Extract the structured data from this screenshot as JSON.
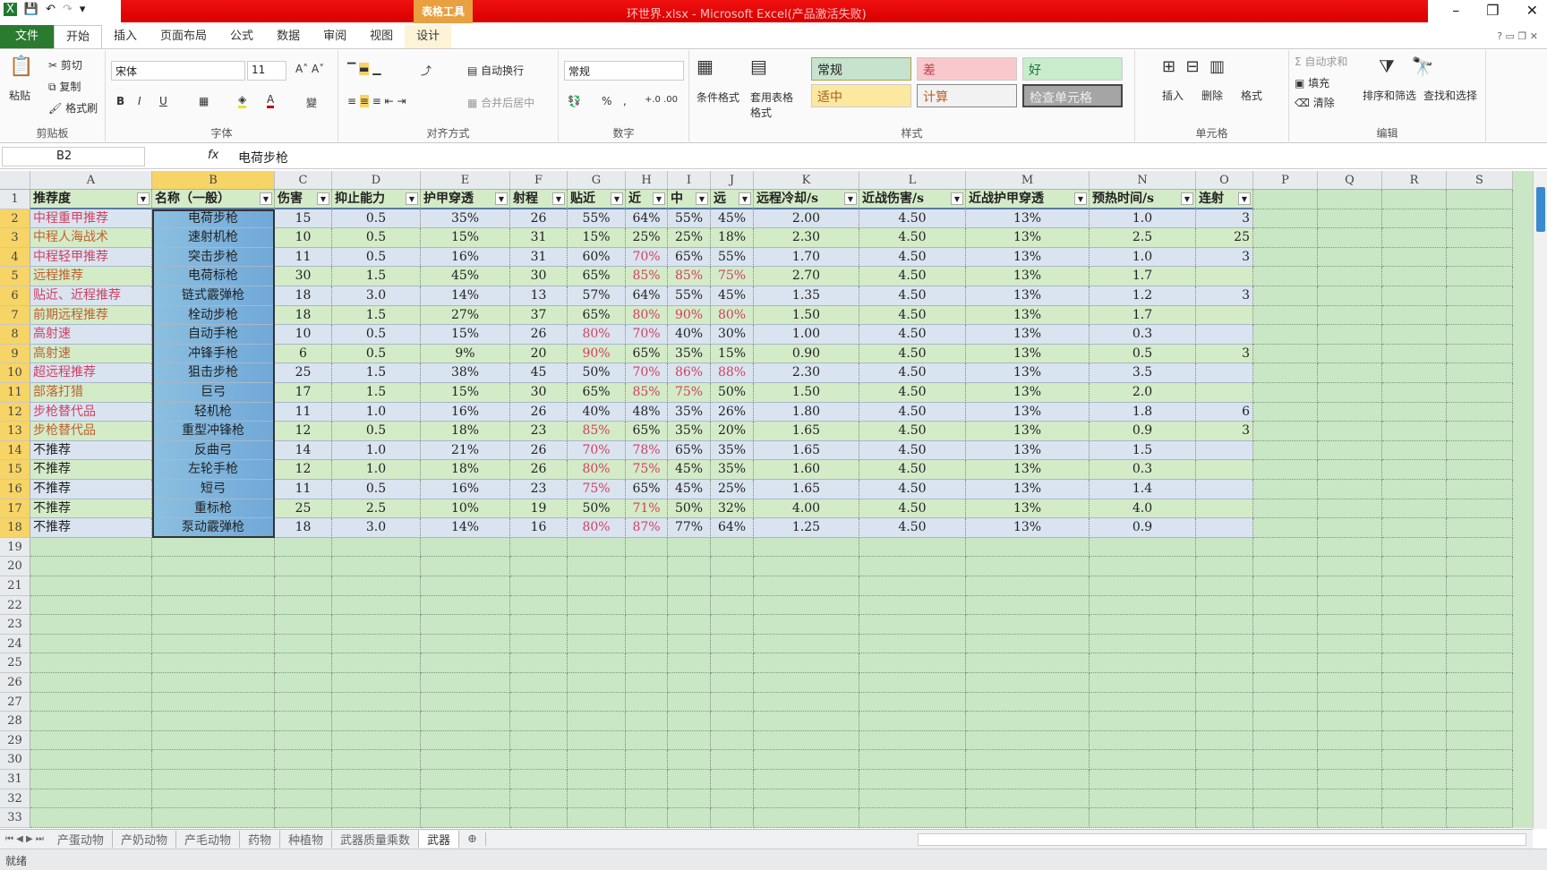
{
  "titlebar": {
    "title": "环世界.xlsx - Microsoft Excel(产品激活失败)",
    "table_tools": "表格工具"
  },
  "tabs": [
    "文件",
    "开始",
    "插入",
    "页面布局",
    "公式",
    "数据",
    "审阅",
    "视图",
    "设计"
  ],
  "ribbon": {
    "clipboard": {
      "paste": "粘贴",
      "cut": "剪切",
      "copy": "复制",
      "format_painter": "格式刷",
      "label": "剪贴板"
    },
    "font": {
      "name": "宋体",
      "size": "11",
      "label": "字体",
      "bold": "B",
      "italic": "I",
      "underline": "U"
    },
    "alignment": {
      "wrap": "自动换行",
      "merge": "合并后居中",
      "label": "对齐方式"
    },
    "number": {
      "format": "常规",
      "percent": "%",
      "comma": ",",
      "label": "数字"
    },
    "styles": {
      "conditional": "条件格式",
      "table_format": "套用表格格式",
      "label": "样式",
      "cells": [
        "常规",
        "差",
        "好",
        "适中",
        "计算",
        "检查单元格"
      ]
    },
    "cells": {
      "insert": "插入",
      "delete": "删除",
      "format": "格式",
      "label": "单元格"
    },
    "editing": {
      "autosum": "自动求和",
      "fill": "填充",
      "clear": "清除",
      "sort": "排序和筛选",
      "find": "查找和选择",
      "label": "编辑"
    }
  },
  "formula_bar": {
    "name_box": "B2",
    "fx": "fx",
    "value": "电荷步枪"
  },
  "columns": [
    "A",
    "B",
    "C",
    "D",
    "E",
    "F",
    "G",
    "H",
    "I",
    "J",
    "K",
    "L",
    "M",
    "N",
    "O",
    "P",
    "Q",
    "R",
    "S"
  ],
  "headers": [
    "推荐度",
    "名称（一般）",
    "伤害",
    "抑止能力",
    "护甲穿透",
    "射程",
    "贴近",
    "近",
    "中",
    "远",
    "远程冷却/s",
    "近战伤害/s",
    "近战护甲穿透",
    "预热时间/s",
    "连射"
  ],
  "rows": [
    [
      "中程重甲推荐",
      "电荷步枪",
      "15",
      "0.5",
      "35%",
      "26",
      "55%",
      "64%",
      "55%",
      "45%",
      "2.00",
      "4.50",
      "13%",
      "1.0",
      "3"
    ],
    [
      "中程人海战术",
      "速射机枪",
      "10",
      "0.5",
      "15%",
      "31",
      "15%",
      "25%",
      "25%",
      "18%",
      "2.30",
      "4.50",
      "13%",
      "2.5",
      "25"
    ],
    [
      "中程轻甲推荐",
      "突击步枪",
      "11",
      "0.5",
      "16%",
      "31",
      "60%",
      "70%",
      "65%",
      "55%",
      "1.70",
      "4.50",
      "13%",
      "1.0",
      "3"
    ],
    [
      "远程推荐",
      "电荷标枪",
      "30",
      "1.5",
      "45%",
      "30",
      "65%",
      "85%",
      "85%",
      "75%",
      "2.70",
      "4.50",
      "13%",
      "1.7",
      ""
    ],
    [
      "贴近、近程推荐",
      "链式霰弹枪",
      "18",
      "3.0",
      "14%",
      "13",
      "57%",
      "64%",
      "55%",
      "45%",
      "1.35",
      "4.50",
      "13%",
      "1.2",
      "3"
    ],
    [
      "前期远程推荐",
      "栓动步枪",
      "18",
      "1.5",
      "27%",
      "37",
      "65%",
      "80%",
      "90%",
      "80%",
      "1.50",
      "4.50",
      "13%",
      "1.7",
      ""
    ],
    [
      "高射速",
      "自动手枪",
      "10",
      "0.5",
      "15%",
      "26",
      "80%",
      "70%",
      "40%",
      "30%",
      "1.00",
      "4.50",
      "13%",
      "0.3",
      ""
    ],
    [
      "高射速",
      "冲锋手枪",
      "6",
      "0.5",
      "9%",
      "20",
      "90%",
      "65%",
      "35%",
      "15%",
      "0.90",
      "4.50",
      "13%",
      "0.5",
      "3"
    ],
    [
      "超远程推荐",
      "狙击步枪",
      "25",
      "1.5",
      "38%",
      "45",
      "50%",
      "70%",
      "86%",
      "88%",
      "2.30",
      "4.50",
      "13%",
      "3.5",
      ""
    ],
    [
      "部落打猎",
      "巨弓",
      "17",
      "1.5",
      "15%",
      "30",
      "65%",
      "85%",
      "75%",
      "50%",
      "1.50",
      "4.50",
      "13%",
      "2.0",
      ""
    ],
    [
      "步枪替代品",
      "轻机枪",
      "11",
      "1.0",
      "16%",
      "26",
      "40%",
      "48%",
      "35%",
      "26%",
      "1.80",
      "4.50",
      "13%",
      "1.8",
      "6"
    ],
    [
      "步枪替代品",
      "重型冲锋枪",
      "12",
      "0.5",
      "18%",
      "23",
      "85%",
      "65%",
      "35%",
      "20%",
      "1.65",
      "4.50",
      "13%",
      "0.9",
      "3"
    ],
    [
      "不推荐",
      "反曲弓",
      "14",
      "1.0",
      "21%",
      "26",
      "70%",
      "78%",
      "65%",
      "35%",
      "1.65",
      "4.50",
      "13%",
      "1.5",
      ""
    ],
    [
      "不推荐",
      "左轮手枪",
      "12",
      "1.0",
      "18%",
      "26",
      "80%",
      "75%",
      "45%",
      "35%",
      "1.60",
      "4.50",
      "13%",
      "0.3",
      ""
    ],
    [
      "不推荐",
      "短弓",
      "11",
      "0.5",
      "16%",
      "23",
      "75%",
      "65%",
      "45%",
      "25%",
      "1.65",
      "4.50",
      "13%",
      "1.4",
      ""
    ],
    [
      "不推荐",
      "重标枪",
      "25",
      "2.5",
      "10%",
      "19",
      "50%",
      "71%",
      "50%",
      "32%",
      "4.00",
      "4.50",
      "13%",
      "4.0",
      ""
    ],
    [
      "不推荐",
      "泵动霰弹枪",
      "18",
      "3.0",
      "14%",
      "16",
      "80%",
      "87%",
      "77%",
      "64%",
      "1.25",
      "4.50",
      "13%",
      "0.9",
      ""
    ]
  ],
  "highlight": {
    "2": [
      7
    ],
    "3": [
      7,
      8,
      9
    ],
    "5": [
      7,
      8,
      9
    ],
    "6": [
      6,
      7
    ],
    "7": [
      6
    ],
    "8": [
      7,
      8,
      9
    ],
    "9": [
      7,
      8
    ],
    "11": [
      6
    ],
    "12": [
      6,
      7
    ],
    "13": [
      6,
      7
    ],
    "14": [
      6
    ],
    "15": [
      7
    ],
    "16": [
      6,
      7
    ]
  },
  "colors": {
    "red_text": "#d04060",
    "title_red": "#e00000",
    "selected_blue": "#7fb3d9",
    "row_blue": "#dae4f0",
    "row_green": "#d4ebc8"
  },
  "sheet_tabs": [
    "产蛋动物",
    "产奶动物",
    "产毛动物",
    "药物",
    "种植物",
    "武器质量乘数",
    "武器"
  ],
  "active_sheet": "武器",
  "status": "就绪"
}
